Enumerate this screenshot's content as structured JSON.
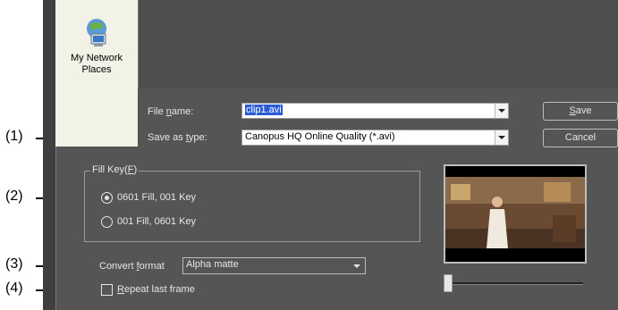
{
  "sidebar": {
    "network_places_label": "My Network Places"
  },
  "fields": {
    "file_name_label_pre": "File ",
    "file_name_label_u": "n",
    "file_name_label_post": "ame:",
    "file_name_value": "clip1.avi",
    "save_type_label_pre": "Save as ",
    "save_type_label_u": "t",
    "save_type_label_post": "ype:",
    "save_type_value": "Canopus HQ Online Quality (*.avi)"
  },
  "buttons": {
    "save_u": "S",
    "save_rest": "ave",
    "cancel": "Cancel"
  },
  "fill_key": {
    "title_pre": "Fill Key(",
    "title_u": "F",
    "title_post": ")",
    "options": [
      "0601 Fill, 001 Key",
      "001 Fill, 0601 Key"
    ],
    "selected_index": 0
  },
  "convert": {
    "label_pre": "Convert ",
    "label_u": "f",
    "label_post": "ormat",
    "value": "Alpha matte"
  },
  "repeat": {
    "label_u": "R",
    "label_rest": "epeat last frame",
    "checked": false
  },
  "callouts": [
    "(1)",
    "(2)",
    "(3)",
    "(4)"
  ],
  "colors": {
    "panel": "#555555",
    "selection": "#2a5cd6",
    "label_text": "#e6e6e6"
  }
}
